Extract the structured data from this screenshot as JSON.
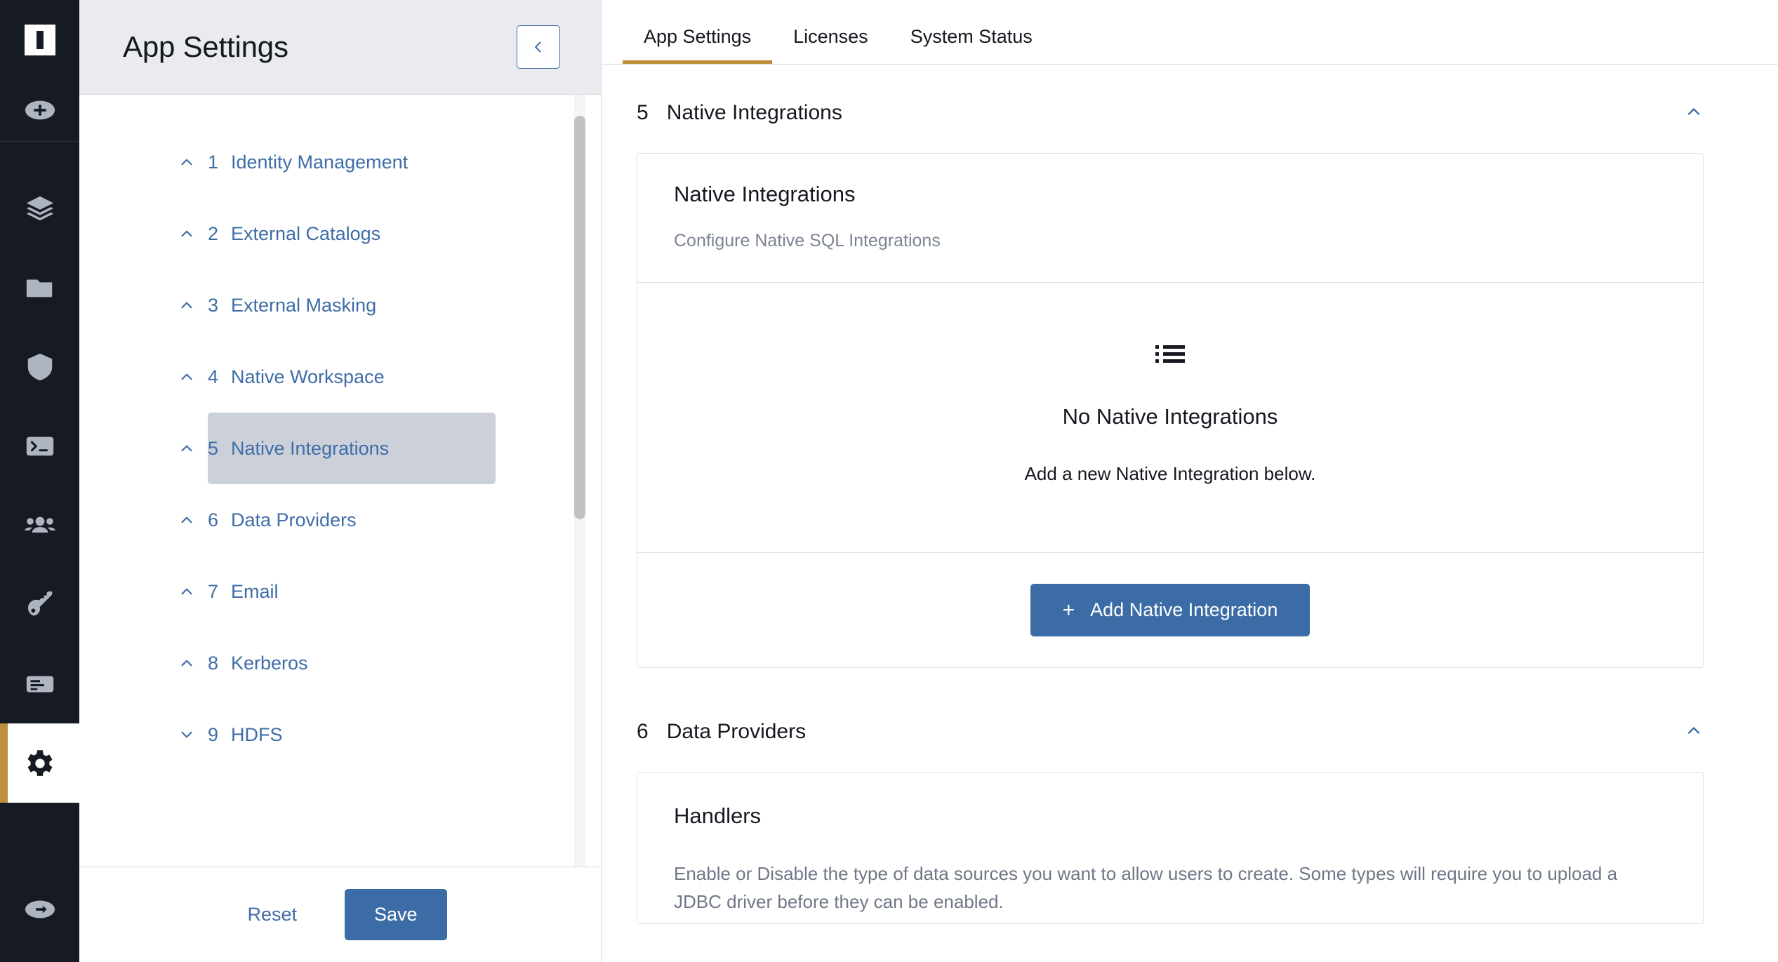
{
  "rail": {
    "logo_name": "app-logo",
    "items": [
      {
        "icon": "plus-circle-icon",
        "name": "add-button",
        "active": false
      },
      {
        "icon": "layers-icon",
        "name": "rail-item-layers",
        "active": false
      },
      {
        "icon": "folder-icon",
        "name": "rail-item-folders",
        "active": false
      },
      {
        "icon": "shield-icon",
        "name": "rail-item-security",
        "active": false
      },
      {
        "icon": "terminal-icon",
        "name": "rail-item-terminal",
        "active": false
      },
      {
        "icon": "users-icon",
        "name": "rail-item-users",
        "active": false
      },
      {
        "icon": "key-icon",
        "name": "rail-item-keys",
        "active": false
      },
      {
        "icon": "report-icon",
        "name": "rail-item-reports",
        "active": false
      },
      {
        "icon": "gear-icon",
        "name": "rail-item-settings",
        "active": true
      }
    ],
    "bottom_icon": "logout-circle-icon"
  },
  "side_panel": {
    "title": "App Settings",
    "collapse_icon": "chevron-left-icon",
    "nav_items": [
      {
        "num": "1",
        "label": "Identity Management",
        "chevron": "chevron-up-icon",
        "selected": false
      },
      {
        "num": "2",
        "label": "External Catalogs",
        "chevron": "chevron-up-icon",
        "selected": false
      },
      {
        "num": "3",
        "label": "External Masking",
        "chevron": "chevron-up-icon",
        "selected": false
      },
      {
        "num": "4",
        "label": "Native Workspace",
        "chevron": "chevron-up-icon",
        "selected": false
      },
      {
        "num": "5",
        "label": "Native Integrations",
        "chevron": "chevron-up-icon",
        "selected": true
      },
      {
        "num": "6",
        "label": "Data Providers",
        "chevron": "chevron-up-icon",
        "selected": false
      },
      {
        "num": "7",
        "label": "Email",
        "chevron": "chevron-up-icon",
        "selected": false
      },
      {
        "num": "8",
        "label": "Kerberos",
        "chevron": "chevron-up-icon",
        "selected": false
      },
      {
        "num": "9",
        "label": "HDFS",
        "chevron": "chevron-down-icon",
        "selected": false
      }
    ],
    "reset_label": "Reset",
    "save_label": "Save"
  },
  "tabs": [
    {
      "label": "App Settings",
      "active": true
    },
    {
      "label": "Licenses",
      "active": false
    },
    {
      "label": "System Status",
      "active": false
    }
  ],
  "sections": {
    "native_integrations": {
      "num": "5",
      "title": "Native Integrations",
      "chevron": "chevron-up-icon",
      "card": {
        "title": "Native Integrations",
        "subtitle": "Configure Native SQL Integrations",
        "empty_icon": "list-icon",
        "empty_title": "No Native Integrations",
        "empty_subtitle": "Add a new Native Integration below.",
        "add_button_label": "Add Native Integration",
        "add_button_icon": "plus-icon"
      }
    },
    "data_providers": {
      "num": "6",
      "title": "Data Providers",
      "chevron": "chevron-up-icon",
      "card": {
        "title": "Handlers",
        "description": "Enable or Disable the type of data sources you want to allow users to create. Some types will require you to upload a JDBC driver before they can be enabled."
      }
    }
  },
  "colors": {
    "rail_bg": "#161A23",
    "accent_gold": "#BE8E3C",
    "link_blue": "#3F6DA7",
    "primary_button": "#3C6CA5",
    "panel_head_bg": "#E9EBEF",
    "selected_row_bg": "#CCD1D9"
  }
}
